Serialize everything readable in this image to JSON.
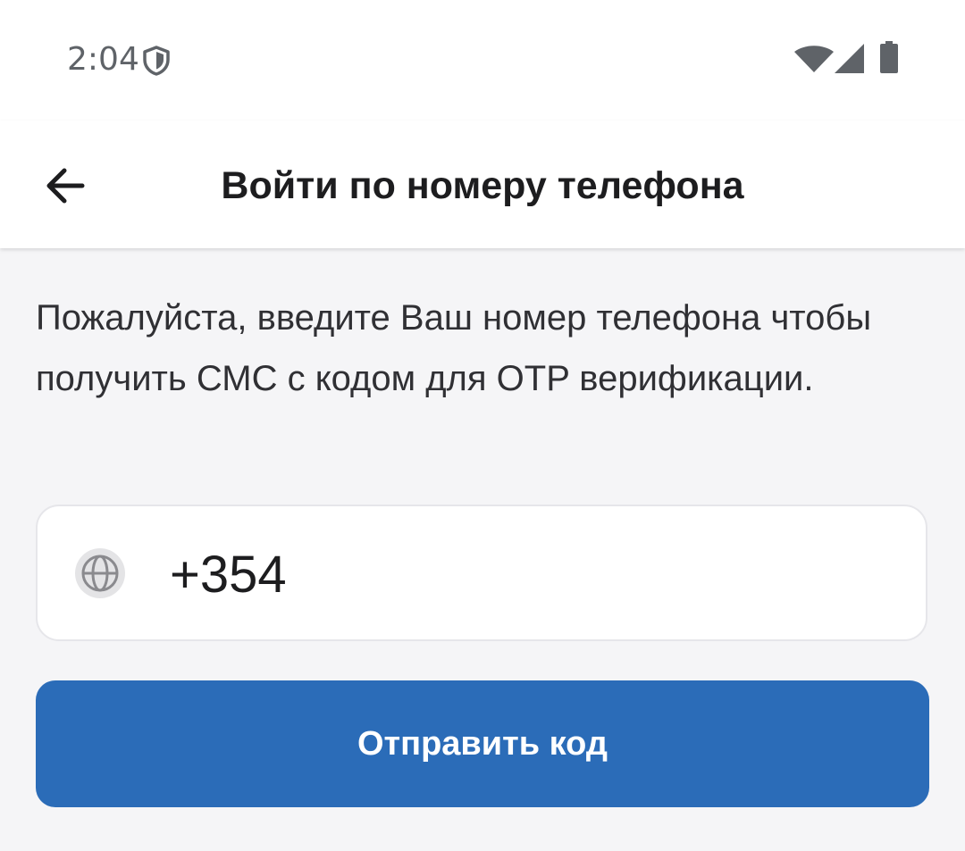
{
  "status_bar": {
    "time": "2:04",
    "icons": [
      "shield-icon",
      "wifi-icon",
      "signal-icon",
      "battery-icon"
    ]
  },
  "app_bar": {
    "back_icon": "arrow-left-icon",
    "title": "Войти по номеру телефона"
  },
  "main": {
    "description": "Пожалуйста, введите Ваш номер телефона чтобы получить СМС с кодом для OTP верификации.",
    "phone_field": {
      "country_icon": "globe-icon",
      "value": "+354"
    },
    "send_button_label": "Отправить код"
  },
  "colors": {
    "background": "#f5f5f7",
    "surface": "#ffffff",
    "primary": "#2b6cb8",
    "text": "#1d1d1f",
    "status_text": "#5f6368"
  }
}
